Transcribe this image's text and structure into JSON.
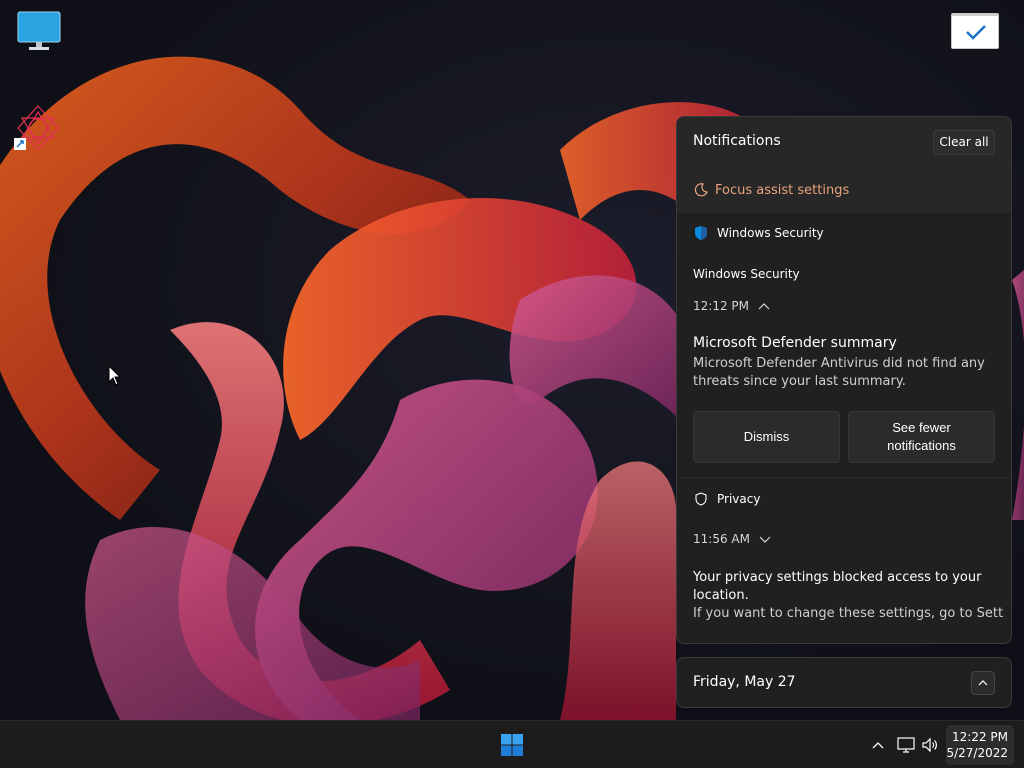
{
  "notifications": {
    "title": "Notifications",
    "clear_all": "Clear all",
    "focus_assist": "Focus assist settings",
    "groups": [
      {
        "app": "Windows Security",
        "items": [
          {
            "app_name": "Windows Security",
            "time": "12:12 PM",
            "title": "Microsoft Defender summary",
            "body": "Microsoft Defender Antivirus did not find any threats since your last summary.",
            "actions": [
              "Dismiss",
              "See fewer notifications"
            ]
          }
        ]
      },
      {
        "app": "Privacy",
        "items": [
          {
            "time": "11:56 AM",
            "title": "Your privacy settings blocked access to your location.",
            "body": "If you want to change these settings, go to Settin"
          }
        ]
      }
    ]
  },
  "calendar": {
    "date": "Friday, May 27"
  },
  "taskbar": {
    "time": "12:22 PM",
    "date": "5/27/2022"
  },
  "icons": {
    "start": "windows-logo-icon",
    "tray_overflow": "chevron-up-icon",
    "network": "network-icon",
    "volume": "volume-icon",
    "focus_assist": "moon-icon",
    "security": "shield-icon",
    "privacy": "shield-outline-icon"
  },
  "colors": {
    "accent_link": "#e8a27c",
    "windows_blue": "#0a8be0",
    "panel_bg": "#202020"
  }
}
